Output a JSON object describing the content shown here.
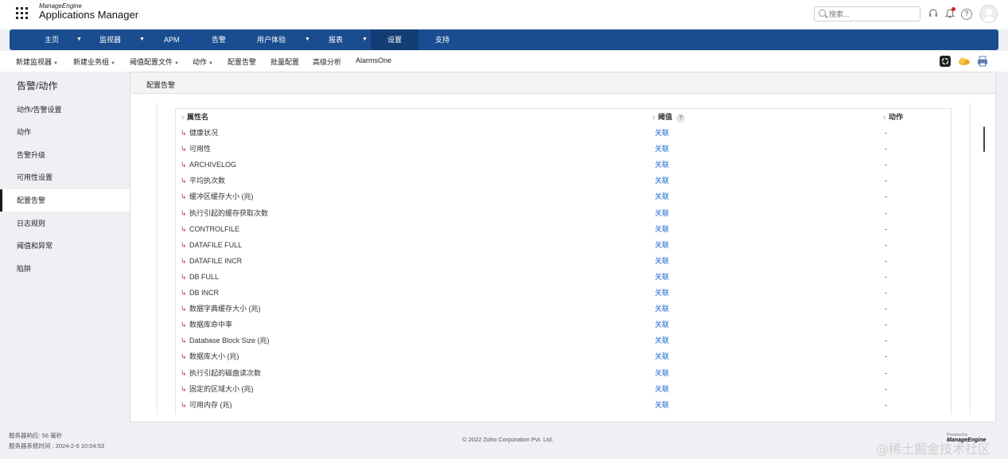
{
  "brand": {
    "small": "ManageEngine",
    "name": "Applications Manager"
  },
  "search": {
    "placeholder": "搜索..."
  },
  "main_nav": [
    {
      "label": "主页",
      "has_caret": true
    },
    {
      "label": "监视器",
      "has_caret": true
    },
    {
      "label": "APM",
      "has_caret": false
    },
    {
      "label": "告警",
      "has_caret": false
    },
    {
      "label": "用户体验",
      "has_caret": true
    },
    {
      "label": "报表",
      "has_caret": true
    },
    {
      "label": "设置",
      "has_caret": false,
      "active": true
    },
    {
      "label": "支持",
      "has_caret": false
    }
  ],
  "sub_nav": [
    {
      "label": "新建监视器",
      "dropdown": true
    },
    {
      "label": "新建业务组",
      "dropdown": true
    },
    {
      "label": "阈值配置文件",
      "dropdown": true
    },
    {
      "label": "动作",
      "dropdown": true
    },
    {
      "label": "配置告警",
      "dropdown": false
    },
    {
      "label": "批量配置",
      "dropdown": false
    },
    {
      "label": "高级分析",
      "dropdown": false
    },
    {
      "label": "AlarmsOne",
      "dropdown": false
    }
  ],
  "sidebar": {
    "title": "告警/动作",
    "items": [
      {
        "label": "动作/告警设置"
      },
      {
        "label": "动作"
      },
      {
        "label": "告警升级"
      },
      {
        "label": "可用性设置"
      },
      {
        "label": "配置告警",
        "active": true
      },
      {
        "label": "日志规则"
      },
      {
        "label": "阈值和异常"
      },
      {
        "label": "陷阱"
      }
    ]
  },
  "panel": {
    "title": "配置告警",
    "columns": {
      "name": "属性名",
      "threshold": "阈值",
      "threshold_help": "?",
      "action": "动作"
    },
    "rows": [
      {
        "name": "健康状况",
        "threshold": "关联",
        "action": "-"
      },
      {
        "name": "可用性",
        "threshold": "关联",
        "action": "-"
      },
      {
        "name": "ARCHIVELOG",
        "threshold": "关联",
        "action": "-"
      },
      {
        "name": "平均执次数",
        "threshold": "关联",
        "action": "-"
      },
      {
        "name": "缓冲区缓存大小 (兆)",
        "threshold": "关联",
        "action": "-"
      },
      {
        "name": "执行引起的缓存获取次数",
        "threshold": "关联",
        "action": "-"
      },
      {
        "name": "CONTROLFILE",
        "threshold": "关联",
        "action": "-"
      },
      {
        "name": "DATAFILE FULL",
        "threshold": "关联",
        "action": "-"
      },
      {
        "name": "DATAFILE INCR",
        "threshold": "关联",
        "action": "-"
      },
      {
        "name": "DB FULL",
        "threshold": "关联",
        "action": "-"
      },
      {
        "name": "DB INCR",
        "threshold": "关联",
        "action": "-"
      },
      {
        "name": "数据字典缓存大小 (兆)",
        "threshold": "关联",
        "action": "-"
      },
      {
        "name": "数据库命中率",
        "threshold": "关联",
        "action": "-"
      },
      {
        "name": "Database Block Size (兆)",
        "threshold": "关联",
        "action": "-"
      },
      {
        "name": "数据库大小 (兆)",
        "threshold": "关联",
        "action": "-"
      },
      {
        "name": "执行引起的磁盘读次数",
        "threshold": "关联",
        "action": "-"
      },
      {
        "name": "固定的区域大小 (兆)",
        "threshold": "关联",
        "action": "-"
      },
      {
        "name": "可用内存 (兆)",
        "threshold": "关联",
        "action": "-"
      }
    ]
  },
  "footer": {
    "response": "服务器响应: 56 毫秒",
    "server_time": "服务器系统时间 : 2024-2-6 10:04:53",
    "copyright": "© 2022 Zoho Corporation Pvt. Ltd.",
    "powered_by": "Powered by",
    "powered_logo": "ManageEngine"
  },
  "watermark": "@稀土掘金技术社区",
  "colors": {
    "nav_bg": "#1a4d8f",
    "nav_active": "#123d75",
    "link": "#1b6ad1",
    "row_arrow": "#d23b3b"
  }
}
